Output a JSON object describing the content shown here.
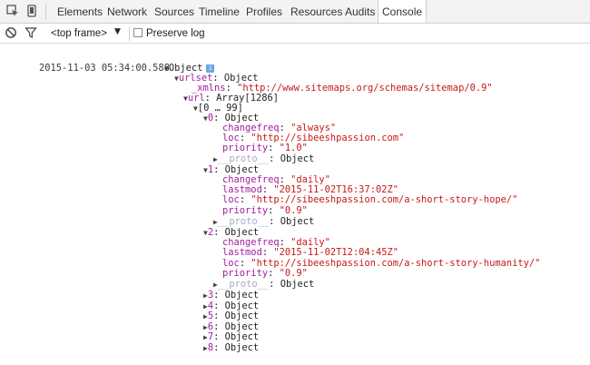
{
  "toolbar": {
    "tabs": [
      "Elements",
      "Network",
      "Sources",
      "Timeline",
      "Profiles",
      "Resources",
      "Audits",
      "Console"
    ],
    "active_tab": "Console"
  },
  "console_bar": {
    "frame_label": "<top frame>",
    "preserve_log_label": "Preserve log",
    "preserve_log_checked": false
  },
  "log": {
    "timestamp": "2015-11-03 05:34:00.588",
    "root_label": "Object",
    "urlset_key": "urlset",
    "urlset_type": "Object",
    "xmlns_key": "_xmlns",
    "xmlns_value": "\"http://www.sitemaps.org/schemas/sitemap/0.9\"",
    "url_key": "url",
    "url_type": "Array[1286]",
    "range_label": "[0 … 99]",
    "items": [
      {
        "index": "0",
        "type": "Object",
        "changefreq": "\"always\"",
        "loc": "\"http://sibeeshpassion.com\"",
        "priority": "\"1.0\"",
        "proto_key": "__proto__",
        "proto_val": "Object"
      },
      {
        "index": "1",
        "type": "Object",
        "changefreq": "\"daily\"",
        "lastmod": "\"2015-11-02T16:37:02Z\"",
        "loc": "\"http://sibeeshpassion.com/a-short-story-hope/\"",
        "priority": "\"0.9\"",
        "proto_key": "__proto__",
        "proto_val": "Object"
      },
      {
        "index": "2",
        "type": "Object",
        "changefreq": "\"daily\"",
        "lastmod": "\"2015-11-02T12:04:45Z\"",
        "loc": "\"http://sibeeshpassion.com/a-short-story-humanity/\"",
        "priority": "\"0.9\"",
        "proto_key": "__proto__",
        "proto_val": "Object"
      }
    ],
    "collapsed": [
      {
        "index": "3",
        "type": "Object"
      },
      {
        "index": "4",
        "type": "Object"
      },
      {
        "index": "5",
        "type": "Object"
      },
      {
        "index": "6",
        "type": "Object"
      },
      {
        "index": "7",
        "type": "Object"
      },
      {
        "index": "8",
        "type": "Object"
      }
    ]
  },
  "colors": {
    "key": "#a11ca2",
    "string": "#c41a16",
    "info_badge": "#6da5e3"
  },
  "icons": [
    "inspect-icon",
    "device-mode-icon",
    "clear-console-icon",
    "filter-icon",
    "info-icon",
    "expand-triangle-icon",
    "collapse-triangle-icon"
  ]
}
